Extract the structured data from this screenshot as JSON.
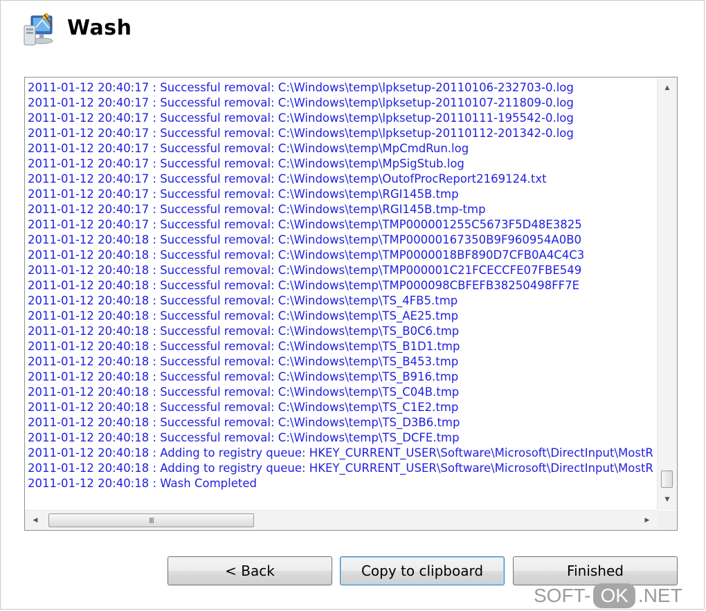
{
  "header": {
    "title": "Wash",
    "icon": "computer-cleaner-icon"
  },
  "log": {
    "lines": [
      "2011-01-12 20:40:17 : Successful removal: C:\\Windows\\temp\\lpksetup-20110106-232703-0.log",
      "2011-01-12 20:40:17 : Successful removal: C:\\Windows\\temp\\lpksetup-20110107-211809-0.log",
      "2011-01-12 20:40:17 : Successful removal: C:\\Windows\\temp\\lpksetup-20110111-195542-0.log",
      "2011-01-12 20:40:17 : Successful removal: C:\\Windows\\temp\\lpksetup-20110112-201342-0.log",
      "2011-01-12 20:40:17 : Successful removal: C:\\Windows\\temp\\MpCmdRun.log",
      "2011-01-12 20:40:17 : Successful removal: C:\\Windows\\temp\\MpSigStub.log",
      "2011-01-12 20:40:17 : Successful removal: C:\\Windows\\temp\\OutofProcReport2169124.txt",
      "2011-01-12 20:40:17 : Successful removal: C:\\Windows\\temp\\RGI145B.tmp",
      "2011-01-12 20:40:17 : Successful removal: C:\\Windows\\temp\\RGI145B.tmp-tmp",
      "2011-01-12 20:40:17 : Successful removal: C:\\Windows\\temp\\TMP000001255C5673F5D48E3825",
      "2011-01-12 20:40:18 : Successful removal: C:\\Windows\\temp\\TMP00000167350B9F960954A0B0",
      "2011-01-12 20:40:18 : Successful removal: C:\\Windows\\temp\\TMP0000018BF890D7CFB0A4C4C3",
      "2011-01-12 20:40:18 : Successful removal: C:\\Windows\\temp\\TMP000001C21FCECCFE07FBE549",
      "2011-01-12 20:40:18 : Successful removal: C:\\Windows\\temp\\TMP000098CBFEFB38250498FF7E",
      "2011-01-12 20:40:18 : Successful removal: C:\\Windows\\temp\\TS_4FB5.tmp",
      "2011-01-12 20:40:18 : Successful removal: C:\\Windows\\temp\\TS_AE25.tmp",
      "2011-01-12 20:40:18 : Successful removal: C:\\Windows\\temp\\TS_B0C6.tmp",
      "2011-01-12 20:40:18 : Successful removal: C:\\Windows\\temp\\TS_B1D1.tmp",
      "2011-01-12 20:40:18 : Successful removal: C:\\Windows\\temp\\TS_B453.tmp",
      "2011-01-12 20:40:18 : Successful removal: C:\\Windows\\temp\\TS_B916.tmp",
      "2011-01-12 20:40:18 : Successful removal: C:\\Windows\\temp\\TS_C04B.tmp",
      "2011-01-12 20:40:18 : Successful removal: C:\\Windows\\temp\\TS_C1E2.tmp",
      "2011-01-12 20:40:18 : Successful removal: C:\\Windows\\temp\\TS_D3B6.tmp",
      "2011-01-12 20:40:18 : Successful removal: C:\\Windows\\temp\\TS_DCFE.tmp",
      "2011-01-12 20:40:18 : Adding to registry queue: HKEY_CURRENT_USER\\Software\\Microsoft\\DirectInput\\MostR",
      "2011-01-12 20:40:18 : Adding to registry queue: HKEY_CURRENT_USER\\Software\\Microsoft\\DirectInput\\MostR",
      "2011-01-12 20:40:18 : Wash Completed"
    ],
    "text_color": "#1f1fe0",
    "hscroll_grip": "III"
  },
  "buttons": {
    "back": "< Back",
    "copy": "Copy to clipboard",
    "finished": "Finished"
  },
  "watermark": {
    "left": "SOFT-",
    "ok": "OK",
    "right": ".NET"
  }
}
